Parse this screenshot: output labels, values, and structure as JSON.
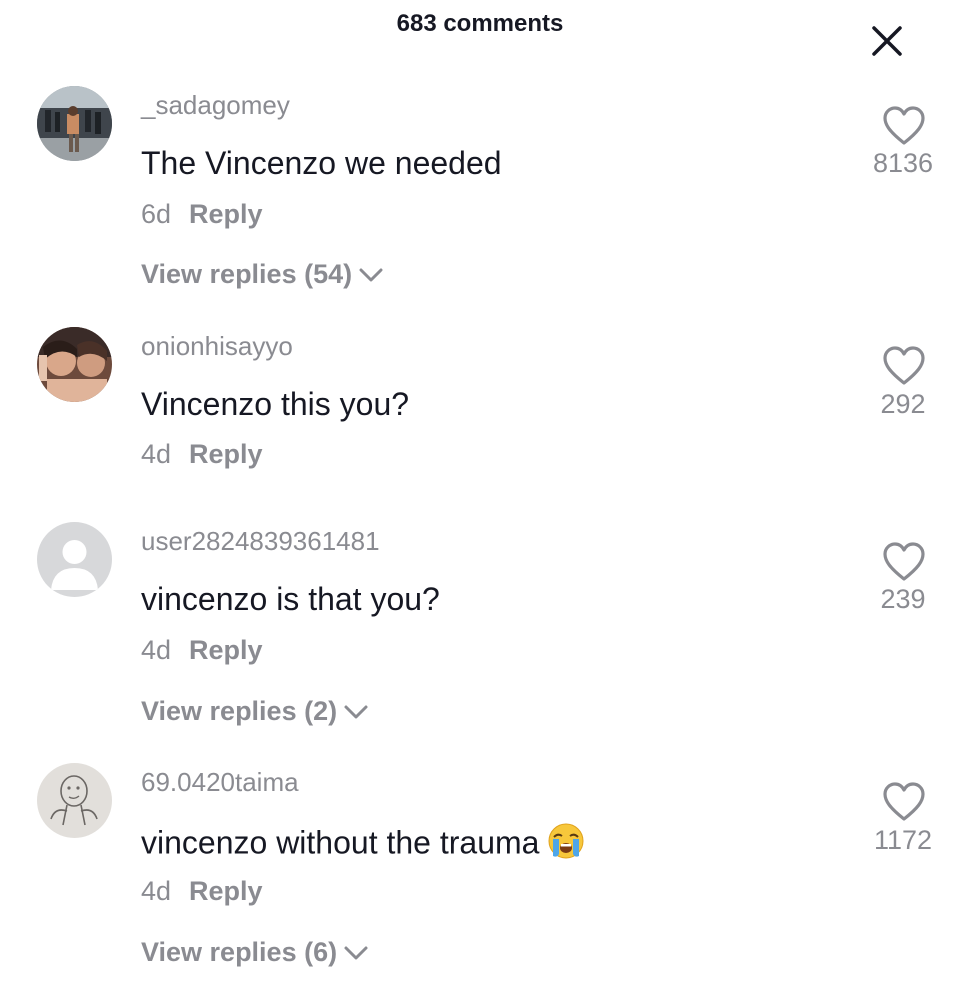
{
  "header": {
    "title": "683 comments",
    "close_icon": "close-icon"
  },
  "colors": {
    "text": "#161823",
    "muted": "#8a8b91"
  },
  "comments": [
    {
      "username": "_sadagomey",
      "text": "The Vincenzo we needed",
      "age": "6d",
      "reply_label": "Reply",
      "likes": "8136",
      "view_replies": "View replies (54)"
    },
    {
      "username": "onionhisayyo",
      "text": "Vincenzo this you?",
      "age": "4d",
      "reply_label": "Reply",
      "likes": "292"
    },
    {
      "username": "user2824839361481",
      "text": "vincenzo is that you?",
      "age": "4d",
      "reply_label": "Reply",
      "likes": "239",
      "view_replies": "View replies (2)"
    },
    {
      "username": "69.0420taima",
      "text": "vincenzo without the trauma",
      "emoji": "loudly-crying-face",
      "age": "4d",
      "reply_label": "Reply",
      "likes": "1172",
      "view_replies": "View replies (6)"
    }
  ]
}
